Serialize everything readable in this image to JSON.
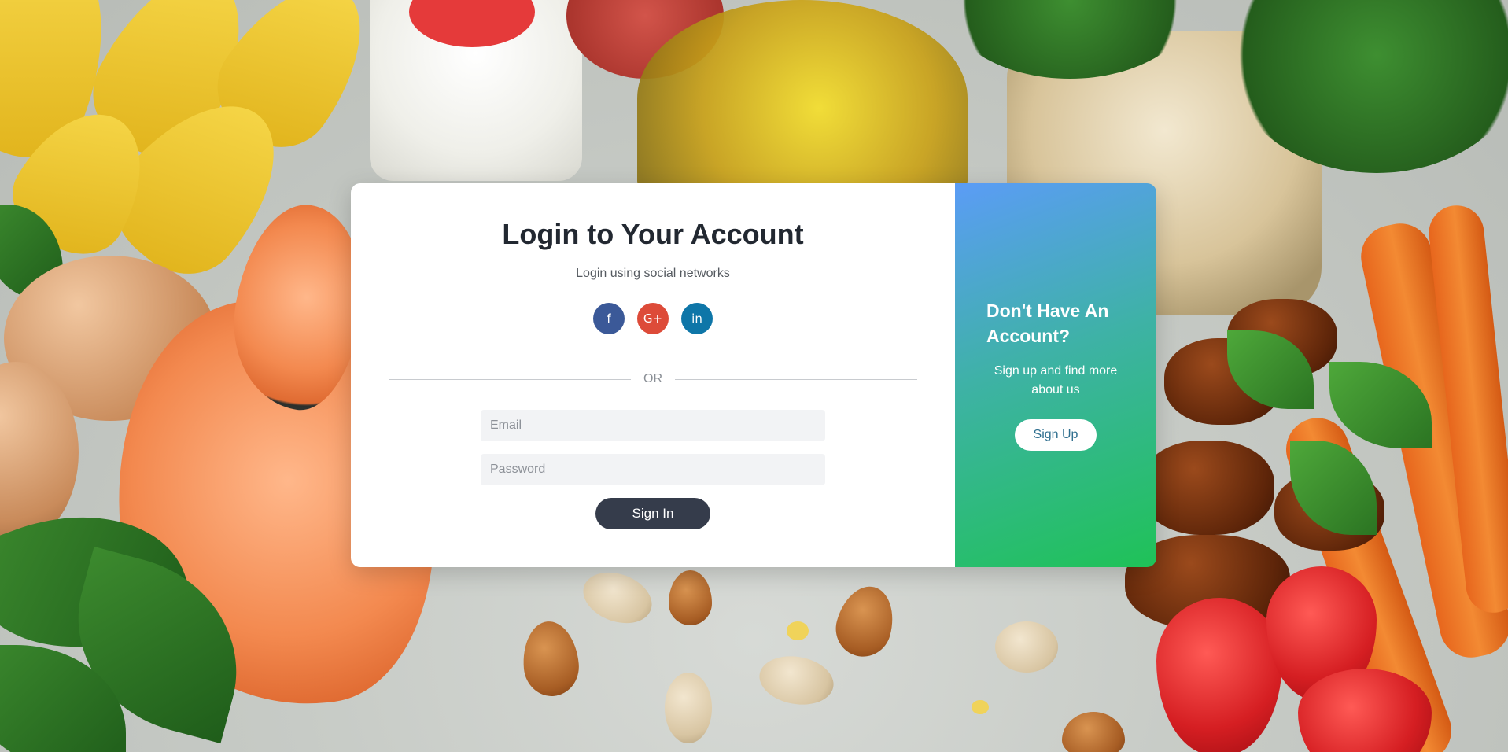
{
  "login": {
    "title": "Login to Your Account",
    "subtitle": "Login using social networks",
    "social": [
      {
        "label": "f",
        "icon": "facebook-icon",
        "color": "#3b5998"
      },
      {
        "label": "G+",
        "icon": "google-plus-icon",
        "color": "#dd4b39"
      },
      {
        "label": "in",
        "icon": "linkedin-icon",
        "color": "#0e76a8"
      }
    ],
    "divider_text": "OR",
    "email_placeholder": "Email",
    "password_placeholder": "Password",
    "signin_label": "Sign In",
    "signin_color": "#353c4b"
  },
  "signup": {
    "title": "Don't Have An Account?",
    "text": "Sign up and find more about us",
    "button_label": "Sign Up",
    "gradient_colors": [
      "#5b9cf6",
      "#1fc257"
    ]
  }
}
